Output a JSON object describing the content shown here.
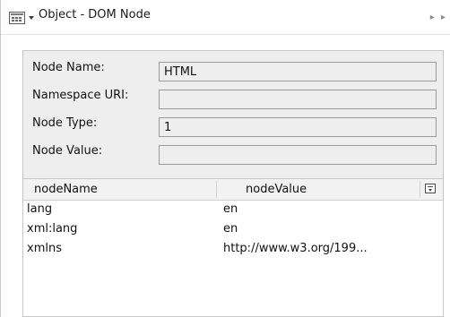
{
  "titlebar": {
    "title": "Object - DOM Node",
    "icon": "grid-view-icon",
    "right_glyph": "▸ ▸"
  },
  "properties": [
    {
      "label": "Node Name:",
      "value": "HTML"
    },
    {
      "label": "Namespace URI:",
      "value": ""
    },
    {
      "label": "Node Type:",
      "value": "1"
    },
    {
      "label": "Node Value:",
      "value": ""
    }
  ],
  "table": {
    "columns": [
      "nodeName",
      "nodeValue"
    ],
    "rows": [
      {
        "name": "lang",
        "value": "en"
      },
      {
        "name": "xml:lang",
        "value": "en"
      },
      {
        "name": "xmlns",
        "value": "http://www.w3.org/199..."
      }
    ]
  },
  "colors": {
    "panel_bg": "#eeeeee",
    "field_border": "#9b9b9b",
    "header_bg": "#f2f2f2"
  }
}
